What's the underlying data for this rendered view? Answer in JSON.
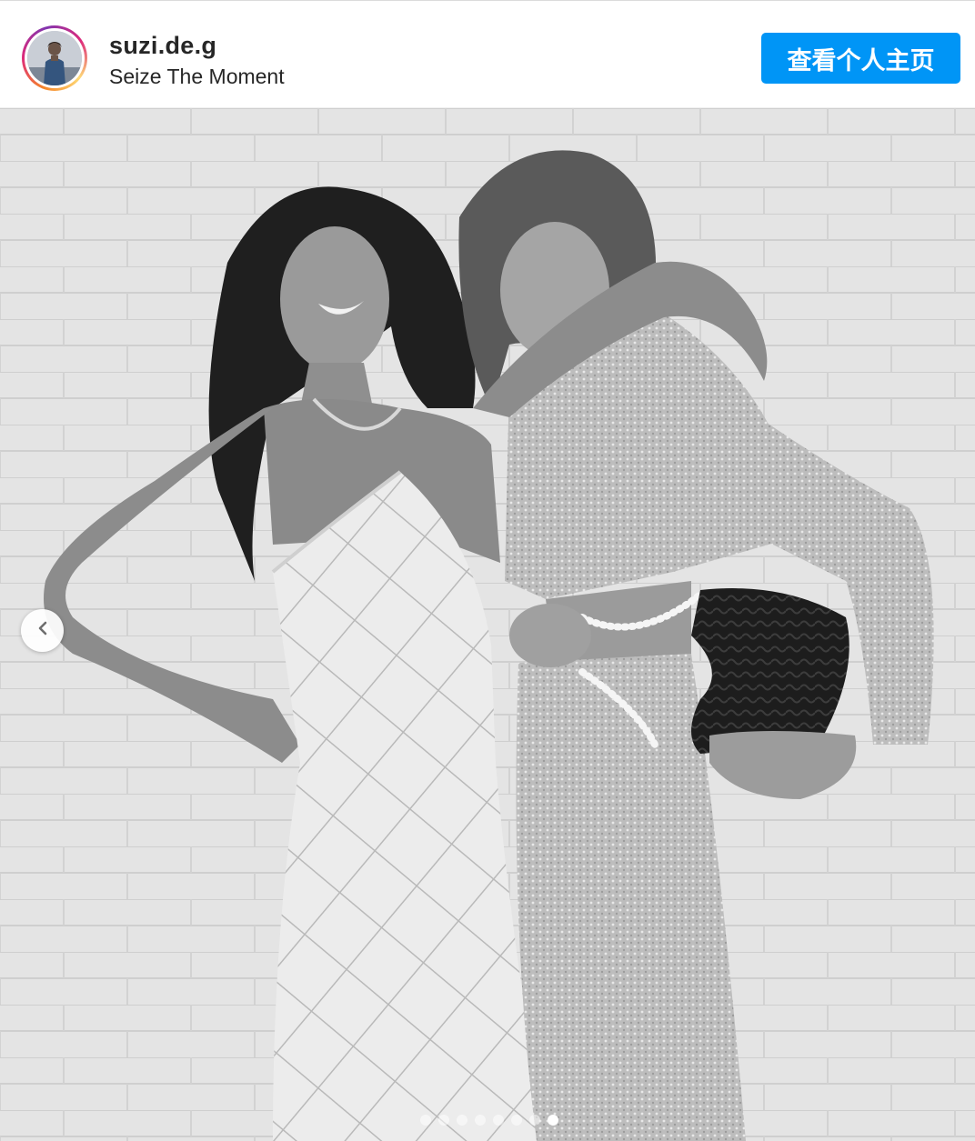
{
  "header": {
    "username": "suzi.de.g",
    "tagline": "Seize The Moment",
    "view_profile_label": "查看个人主页"
  },
  "carousel": {
    "total_slides": 8,
    "active_index": 7,
    "prev_icon": "chevron-left-icon"
  },
  "colors": {
    "button_blue": "#0095f6",
    "avatar_ring": [
      "#f58529",
      "#dd2a7b",
      "#8134af",
      "#feda77"
    ]
  }
}
